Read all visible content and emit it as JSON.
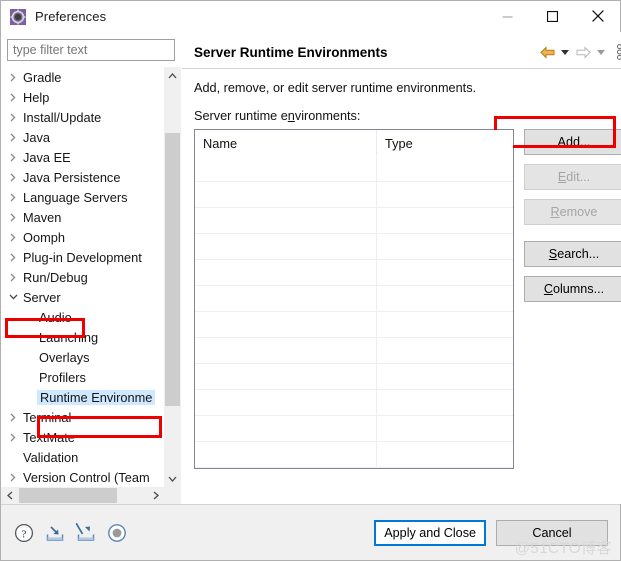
{
  "window": {
    "title": "Preferences",
    "icon": "gear-icon",
    "controls": {
      "minimize": "minimize-icon",
      "maximize": "maximize-icon",
      "close": "close-icon"
    }
  },
  "sidebar": {
    "filter": {
      "placeholder": "type filter text",
      "value": ""
    },
    "items": [
      {
        "label": "Gradle",
        "level": 1,
        "expander": "collapsed",
        "selected": false
      },
      {
        "label": "Help",
        "level": 1,
        "expander": "collapsed",
        "selected": false
      },
      {
        "label": "Install/Update",
        "level": 1,
        "expander": "collapsed",
        "selected": false
      },
      {
        "label": "Java",
        "level": 1,
        "expander": "collapsed",
        "selected": false
      },
      {
        "label": "Java EE",
        "level": 1,
        "expander": "collapsed",
        "selected": false
      },
      {
        "label": "Java Persistence",
        "level": 1,
        "expander": "collapsed",
        "selected": false
      },
      {
        "label": "Language Servers",
        "level": 1,
        "expander": "collapsed",
        "selected": false
      },
      {
        "label": "Maven",
        "level": 1,
        "expander": "collapsed",
        "selected": false
      },
      {
        "label": "Oomph",
        "level": 1,
        "expander": "collapsed",
        "selected": false
      },
      {
        "label": "Plug-in Development",
        "level": 1,
        "expander": "collapsed",
        "selected": false
      },
      {
        "label": "Run/Debug",
        "level": 1,
        "expander": "collapsed",
        "selected": false
      },
      {
        "label": "Server",
        "level": 1,
        "expander": "expanded",
        "selected": false,
        "highlighted": true
      },
      {
        "label": "Audio",
        "level": 2,
        "expander": "none",
        "selected": false
      },
      {
        "label": "Launching",
        "level": 2,
        "expander": "none",
        "selected": false
      },
      {
        "label": "Overlays",
        "level": 2,
        "expander": "none",
        "selected": false
      },
      {
        "label": "Profilers",
        "level": 2,
        "expander": "none",
        "selected": false
      },
      {
        "label": "Runtime Environme",
        "level": 2,
        "expander": "none",
        "selected": true,
        "highlighted": true
      },
      {
        "label": "Terminal",
        "level": 1,
        "expander": "collapsed",
        "selected": false
      },
      {
        "label": "TextMate",
        "level": 1,
        "expander": "collapsed",
        "selected": false
      },
      {
        "label": "Validation",
        "level": 1,
        "expander": "none",
        "selected": false
      },
      {
        "label": "Version Control (Team",
        "level": 1,
        "expander": "collapsed",
        "selected": false
      }
    ],
    "scrollbar": {
      "up_arrow": "chevron-up-icon",
      "down_arrow": "chevron-down-icon",
      "left_arrow": "chevron-left-icon",
      "right_arrow": "chevron-right-icon"
    }
  },
  "page": {
    "title": "Server Runtime Environments",
    "description": "Add, remove, or edit server runtime environments.",
    "list_label": "Server runtime environments:",
    "list_label_mnemonic": "n",
    "toolbar": {
      "back": "back-arrow-icon",
      "back_menu": "caret-down-icon",
      "forward": "forward-arrow-icon",
      "forward_menu": "caret-down-icon",
      "menu": "vertical-dots-icon"
    },
    "table": {
      "columns": [
        "Name",
        "Type"
      ],
      "rows": []
    },
    "buttons": [
      {
        "label": "Add...",
        "mnemonic": "A",
        "enabled": true,
        "highlighted": true
      },
      {
        "label": "Edit...",
        "mnemonic": "E",
        "enabled": false,
        "highlighted": false
      },
      {
        "label": "Remove",
        "mnemonic": "R",
        "enabled": false,
        "highlighted": false
      },
      {
        "label": "Search...",
        "mnemonic": "S",
        "enabled": true,
        "highlighted": false
      },
      {
        "label": "Columns...",
        "mnemonic": "C",
        "enabled": true,
        "highlighted": false
      }
    ]
  },
  "footer": {
    "icons": [
      {
        "name": "help-icon"
      },
      {
        "name": "import-icon"
      },
      {
        "name": "export-icon"
      },
      {
        "name": "restore-defaults-icon"
      }
    ],
    "apply_label": "Apply and Close",
    "cancel_label": "Cancel"
  },
  "watermark": "@51CTO博客",
  "colors": {
    "accent": "#0078d7",
    "highlight_box": "#ee0000",
    "selection": "#cde8ff",
    "back_arrow": "#e8a33d"
  }
}
